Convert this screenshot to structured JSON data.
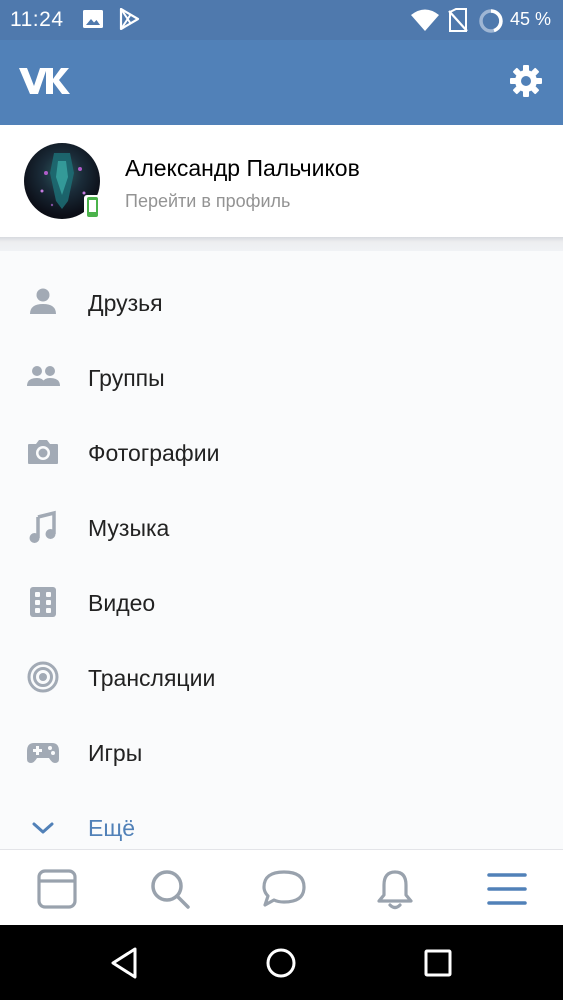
{
  "status_bar": {
    "time": "11:24",
    "battery_text": "45 %",
    "icons": [
      "image-icon",
      "play-store-icon",
      "wifi-icon",
      "no-sim-icon",
      "battery-ring-icon"
    ]
  },
  "app_bar": {
    "logo_icon": "vk-logo-icon",
    "settings_icon": "gear-icon",
    "background": "#5181b8"
  },
  "profile": {
    "name": "Александр Пальчиков",
    "subtitle": "Перейти в профиль",
    "online_badge_icon": "mobile-phone-icon"
  },
  "menu": {
    "items": [
      {
        "label": "Друзья",
        "icon": "person-icon"
      },
      {
        "label": "Группы",
        "icon": "people-icon"
      },
      {
        "label": "Фотографии",
        "icon": "camera-icon"
      },
      {
        "label": "Музыка",
        "icon": "music-note-icon"
      },
      {
        "label": "Видео",
        "icon": "video-icon"
      },
      {
        "label": "Трансляции",
        "icon": "broadcast-icon"
      },
      {
        "label": "Игры",
        "icon": "gamepad-icon"
      },
      {
        "label": "Ещё",
        "icon": "chevron-down-icon"
      }
    ]
  },
  "bottom_nav": {
    "tabs": [
      {
        "name": "news",
        "icon": "newsfeed-icon"
      },
      {
        "name": "search",
        "icon": "search-icon"
      },
      {
        "name": "messages",
        "icon": "message-icon"
      },
      {
        "name": "notifications",
        "icon": "bell-icon"
      },
      {
        "name": "menu",
        "icon": "menu-icon",
        "active": true
      }
    ],
    "active_color": "#5181b8",
    "inactive_color": "#99a2ad"
  },
  "system_nav": {
    "buttons": [
      "back-icon",
      "home-icon",
      "recents-icon"
    ]
  }
}
